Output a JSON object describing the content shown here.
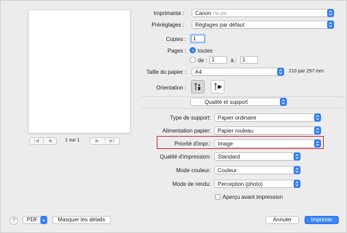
{
  "printer": {
    "label": "Imprimante :",
    "value": "Canon",
    "value_suffix": "TM-305"
  },
  "presets": {
    "label": "Préréglages :",
    "value": "Réglages par défaut"
  },
  "copies": {
    "label": "Copies :",
    "value": "1"
  },
  "pages": {
    "label": "Pages :",
    "all_label": "toutes",
    "from_label": "de :",
    "from_value": "1",
    "to_label": "à :",
    "to_value": "1"
  },
  "paper_size": {
    "label": "Taille du papier :",
    "value": "A4",
    "dimensions": "210 par 297 mm"
  },
  "orientation": {
    "label": "Orientation :",
    "selected": "portrait"
  },
  "section": {
    "value": "Qualité et support"
  },
  "media_type": {
    "label": "Type de support:",
    "value": "Papier ordinaire"
  },
  "paper_source": {
    "label": "Alimentation papier:",
    "value": "Papier rouleau"
  },
  "print_priority": {
    "label": "Priorité d'impr.:",
    "value": "Image"
  },
  "print_quality": {
    "label": "Qualité d'impression:",
    "value": "Standard"
  },
  "color_mode": {
    "label": "Mode couleur:",
    "value": "Couleur"
  },
  "render_mode": {
    "label": "Mode de rendu:",
    "value": "Perception (photo)"
  },
  "preview_checkbox": {
    "label": "Aperçu avant impression",
    "checked": false
  },
  "page_nav": {
    "first": "|◀",
    "prev": "◀",
    "page_label": "1 sur 1",
    "next": "▶",
    "last": "▶|"
  },
  "footer": {
    "help": "?",
    "pdf": "PDF",
    "hide_details": "Masquer les détails",
    "cancel": "Annuler",
    "print": "Imprimer"
  },
  "colors": {
    "accent": "#2f7cf6",
    "highlight": "#d21e1e"
  }
}
